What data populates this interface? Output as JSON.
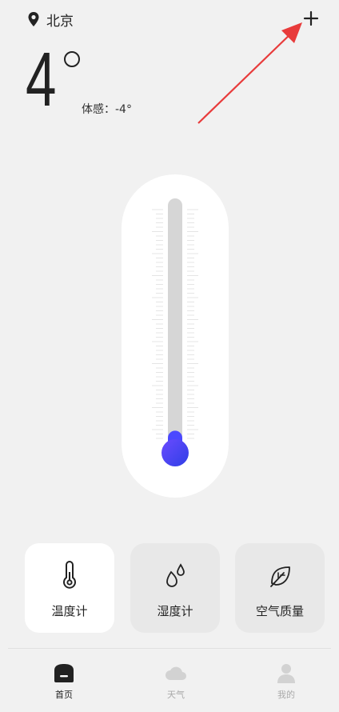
{
  "header": {
    "location_icon": "map-pin-icon",
    "city": "北京",
    "add_icon": "plus-icon"
  },
  "current": {
    "temperature": "4",
    "feels_like": "体感：-4°"
  },
  "thermometer": {
    "level_fraction": 0.06,
    "accent_color": "#4b48ff",
    "tube_color": "#d6d6d6"
  },
  "tiles": [
    {
      "label": "温度计",
      "icon": "thermometer-icon",
      "active": true
    },
    {
      "label": "湿度计",
      "icon": "water-drops-icon",
      "active": false
    },
    {
      "label": "空气质量",
      "icon": "leaf-icon",
      "active": false
    }
  ],
  "nav": [
    {
      "label": "首页",
      "icon": "home-icon",
      "active": true
    },
    {
      "label": "天气",
      "icon": "cloud-icon",
      "active": false
    },
    {
      "label": "我的",
      "icon": "user-icon",
      "active": false
    }
  ],
  "annotation": {
    "arrow_color": "#e83b3b"
  }
}
